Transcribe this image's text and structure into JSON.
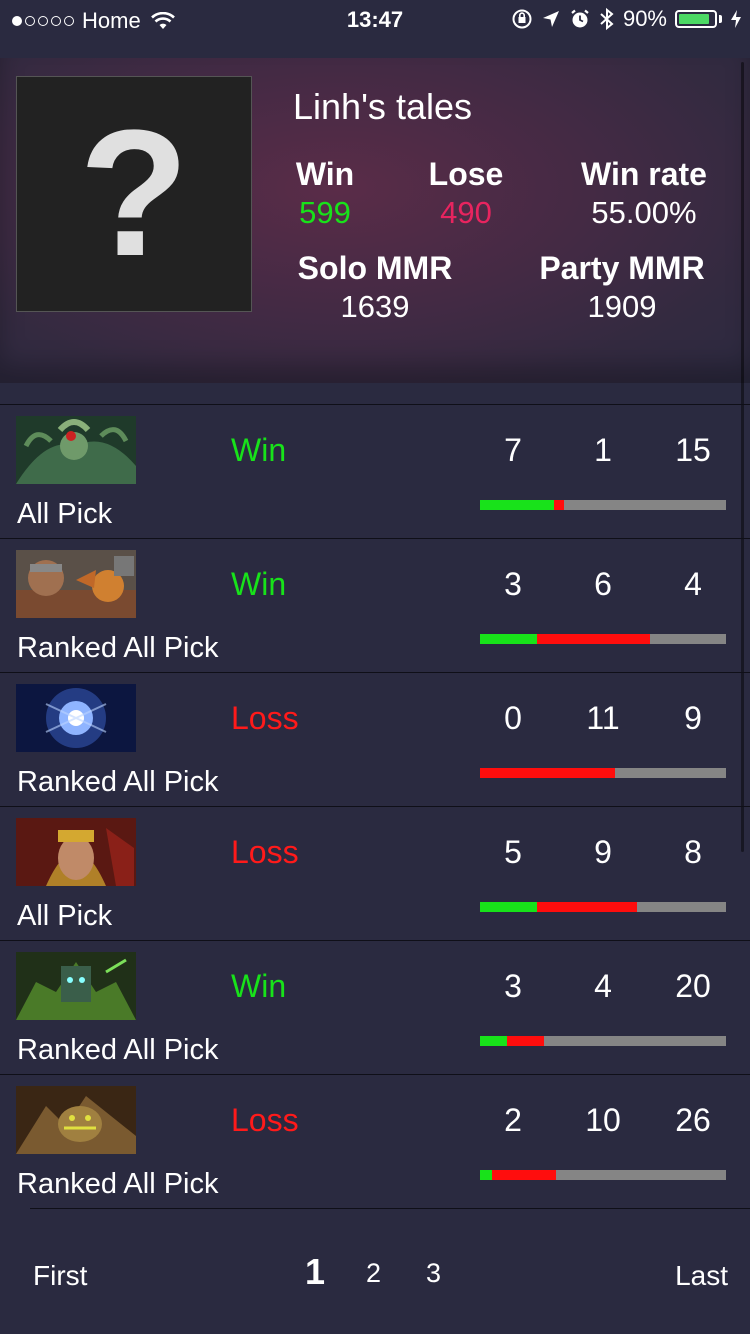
{
  "status_bar": {
    "carrier": "Home",
    "time": "13:47",
    "battery_percent": "90%",
    "battery_level": 0.9,
    "signal_bars": 1,
    "icons": [
      "wifi-icon",
      "rotation-lock-icon",
      "location-icon",
      "alarm-icon",
      "bluetooth-icon",
      "battery-icon",
      "charging-icon"
    ]
  },
  "profile": {
    "name": "Linh's tales",
    "avatar_placeholder": "?",
    "win_label": "Win",
    "win_value": "599",
    "lose_label": "Lose",
    "lose_value": "490",
    "winrate_label": "Win rate",
    "winrate_value": "55.00%",
    "solo_label": "Solo MMR",
    "solo_value": "1639",
    "party_label": "Party MMR",
    "party_value": "1909"
  },
  "colors": {
    "win": "#18e21a",
    "loss": "#ff1a1a",
    "lose_count": "#e8245f",
    "background": "#2a2a40"
  },
  "matches": [
    {
      "hero_icon": "hero-medusa-icon",
      "result": "Win",
      "mode": "All Pick",
      "kills": "7",
      "deaths": "1",
      "assists": "15",
      "bar": {
        "k": 0.3,
        "d": 0.04,
        "a": 0.66
      }
    },
    {
      "hero_icon": "hero-techies-icon",
      "result": "Win",
      "mode": "Ranked All Pick",
      "kills": "3",
      "deaths": "6",
      "assists": "4",
      "bar": {
        "k": 0.23,
        "d": 0.46,
        "a": 0.31
      }
    },
    {
      "hero_icon": "hero-io-icon",
      "result": "Loss",
      "mode": "Ranked All Pick",
      "kills": "0",
      "deaths": "11",
      "assists": "9",
      "bar": {
        "k": 0.0,
        "d": 0.55,
        "a": 0.45
      }
    },
    {
      "hero_icon": "hero-legion-commander-icon",
      "result": "Loss",
      "mode": "All Pick",
      "kills": "5",
      "deaths": "9",
      "assists": "8",
      "bar": {
        "k": 0.23,
        "d": 0.41,
        "a": 0.36
      }
    },
    {
      "hero_icon": "hero-earth-spirit-icon",
      "result": "Win",
      "mode": "Ranked All Pick",
      "kills": "3",
      "deaths": "4",
      "assists": "20",
      "bar": {
        "k": 0.11,
        "d": 0.15,
        "a": 0.74
      }
    },
    {
      "hero_icon": "hero-sand-king-icon",
      "result": "Loss",
      "mode": "Ranked All Pick",
      "kills": "2",
      "deaths": "10",
      "assists": "26",
      "bar": {
        "k": 0.05,
        "d": 0.26,
        "a": 0.69
      }
    }
  ],
  "pagination": {
    "first_label": "First",
    "last_label": "Last",
    "pages": [
      "1",
      "2",
      "3"
    ],
    "current_page": "1"
  }
}
